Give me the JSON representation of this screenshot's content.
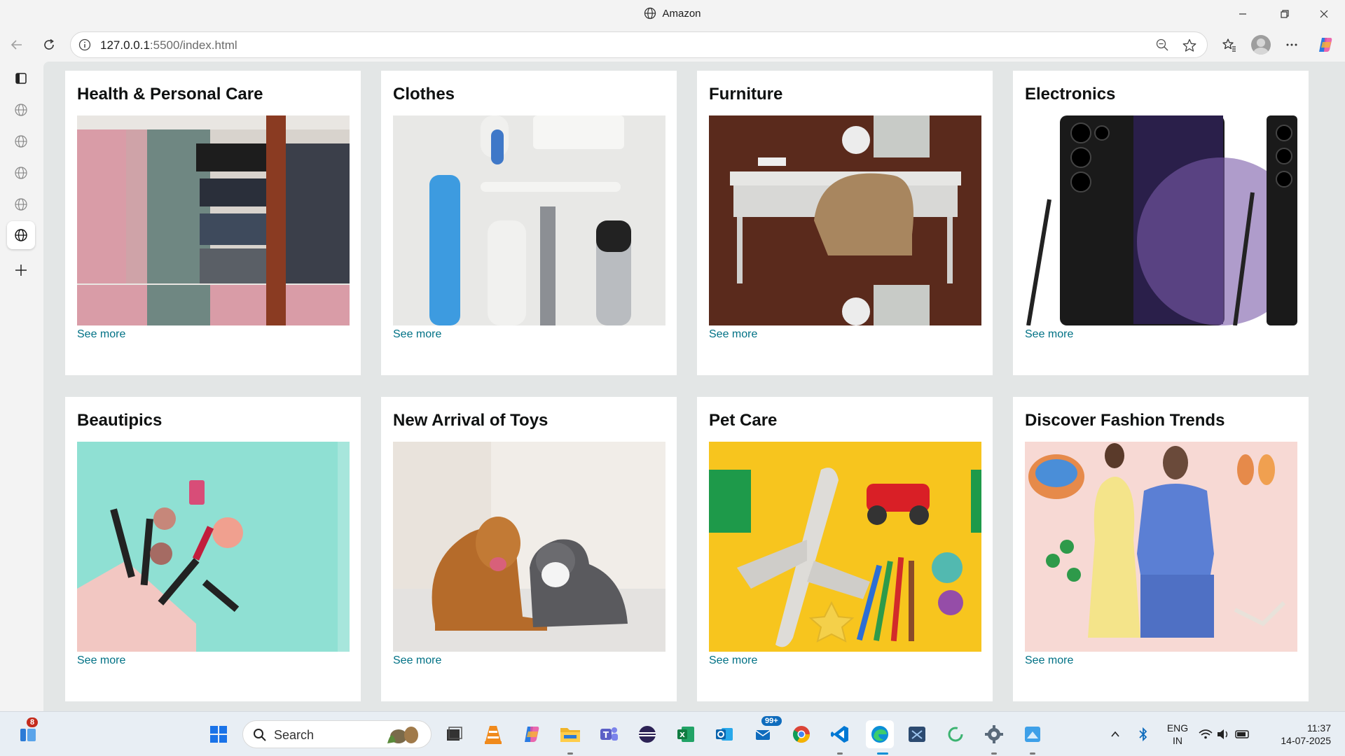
{
  "window": {
    "title": "Amazon"
  },
  "address_bar": {
    "url_host": "127.0.0.1",
    "url_rest": ":5500/index.html"
  },
  "cards": [
    {
      "title": "Health & Personal Care",
      "link": "See more",
      "image": "hangers-with-folded-fabrics"
    },
    {
      "title": "Clothes",
      "link": "See more",
      "image": "toiletries-flat-lay"
    },
    {
      "title": "Furniture",
      "link": "See more",
      "image": "desk-and-chair"
    },
    {
      "title": "Electronics",
      "link": "See more",
      "image": "black-smartphone-with-stylus"
    },
    {
      "title": "Beautipics",
      "link": "See more",
      "image": "makeup-spilling-from-pouch"
    },
    {
      "title": "New Arrival of Toys",
      "link": "See more",
      "image": "dog-and-cat-lying"
    },
    {
      "title": "Pet Care",
      "link": "See more",
      "image": "toy-plane-car-pencils"
    },
    {
      "title": "Discover Fashion Trends",
      "link": "See more",
      "image": "two-models-with-accessories"
    }
  ],
  "taskbar": {
    "search_label": "Search",
    "notification_count": "8",
    "mail_badge": "99+",
    "language_line1": "ENG",
    "language_line2": "IN",
    "time": "11:37",
    "date": "14-07-2025"
  }
}
